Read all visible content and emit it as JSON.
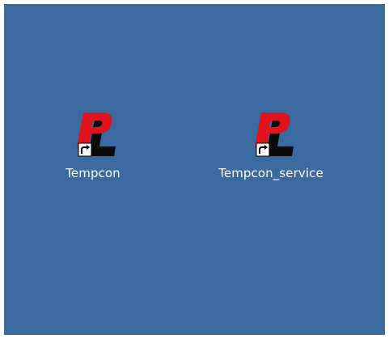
{
  "desktop": {
    "background_color": "#3b6aa0",
    "shortcuts": [
      {
        "label": "Tempcon",
        "icon": "pl-logo-icon",
        "overlay": "shortcut-arrow-icon"
      },
      {
        "label": "Tempcon_service",
        "icon": "pl-logo-icon",
        "overlay": "shortcut-arrow-icon"
      }
    ]
  }
}
